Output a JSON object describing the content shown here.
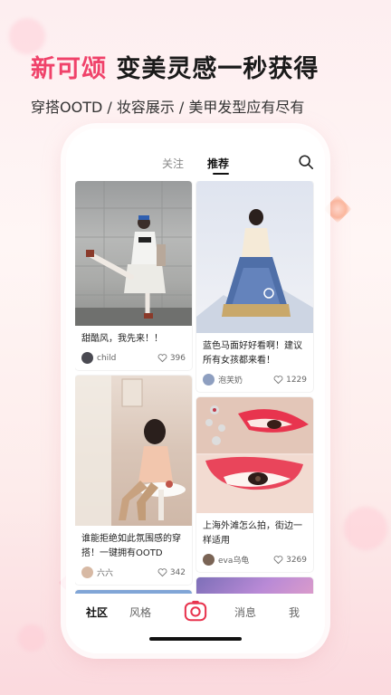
{
  "promo": {
    "brand": "新可颂",
    "slogan": "变美灵感一秒获得",
    "subtitle": "穿搭OOTD / 妆容展示 / 美甲发型应有尽有"
  },
  "app": {
    "tabs": {
      "follow": "关注",
      "recommend": "推荐"
    },
    "search_icon": "search-icon",
    "feed": {
      "left": [
        {
          "caption": "甜酷风，我先来！！",
          "author": "child",
          "likes": "396"
        },
        {
          "caption": "谁能拒绝如此氛围感的穿搭！一键拥有OOTD",
          "author": "六六",
          "likes": "342"
        }
      ],
      "right": [
        {
          "caption": "蓝色马面好好看啊！建议所有女孩都来看！",
          "author": "泡芙奶",
          "likes": "1229"
        },
        {
          "caption": "上海外滩怎么拍，街边一样适用",
          "author": "eva乌龟",
          "likes": "3269"
        }
      ]
    },
    "bottom_nav": {
      "community": "社区",
      "style": "风格",
      "camera_icon": "camera-icon",
      "messages": "消息",
      "me": "我"
    }
  },
  "colors": {
    "brand": "#f0426a",
    "accent": "#e8344e"
  }
}
